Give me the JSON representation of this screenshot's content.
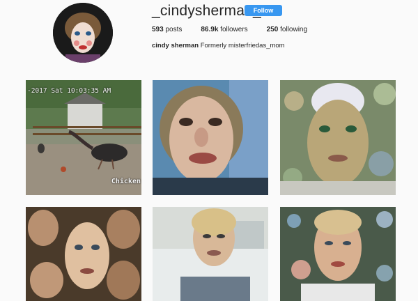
{
  "profile": {
    "username": "_cindysherman_",
    "follow_label": "Follow",
    "stats": {
      "posts_count": "593",
      "posts_label": "posts",
      "followers_count": "86.9k",
      "followers_label": "followers",
      "following_count": "250",
      "following_label": "following"
    },
    "bio": {
      "name": "cindy sherman",
      "text": "Formerly misterfriedas_mom"
    },
    "accent_color": "#3897f0"
  },
  "posts": [
    {
      "timestamp": "-2017 Sat 10:03:35 AM",
      "watermark": "Chicken"
    }
  ]
}
